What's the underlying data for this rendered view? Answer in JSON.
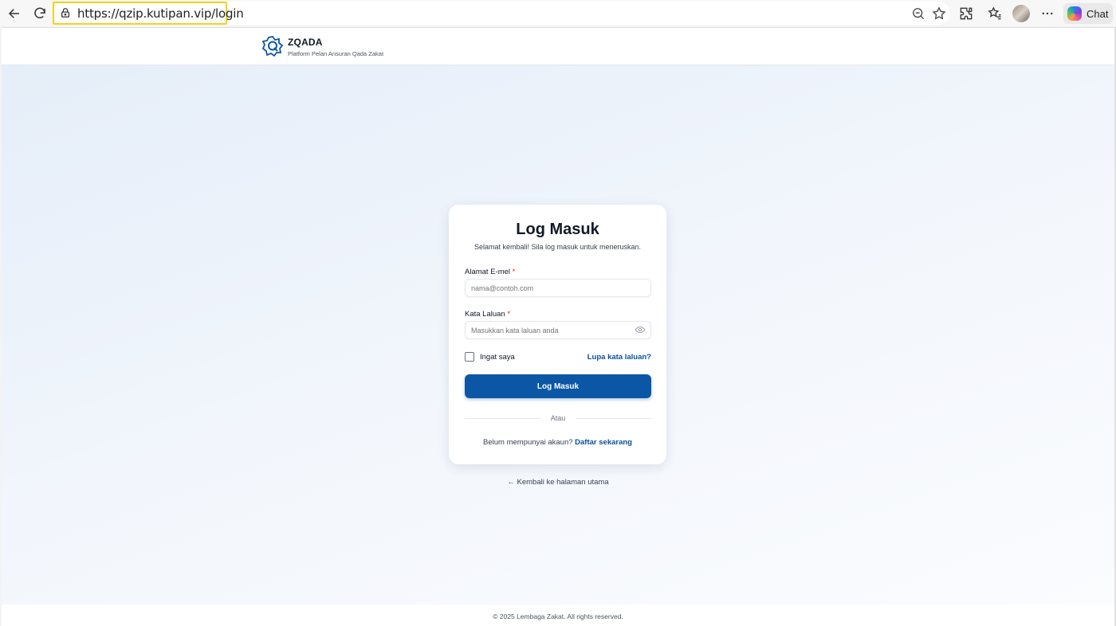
{
  "browser": {
    "url": "https://qzip.kutipan.vip/login",
    "chat_label": "Chat"
  },
  "header": {
    "brand_name": "ZQADA",
    "brand_tagline": "Platform Pelan Ansuran Qada Zakat"
  },
  "login": {
    "title": "Log Masuk",
    "subtitle": "Selamat kembali! Sila log masuk untuk meneruskan.",
    "email_label": "Alamat E-mel",
    "email_placeholder": "nama@contoh.com",
    "password_label": "Kata Laluan",
    "password_placeholder": "Masukkan kata laluan anda",
    "required_mark": "*",
    "remember_label": "Ingat saya",
    "forgot_label": "Lupa kata laluan?",
    "submit_label": "Log Masuk",
    "divider_label": "Atau",
    "signup_prompt": "Belum mempunyai akaun?",
    "signup_link": "Daftar sekarang"
  },
  "back_home": "← Kembali ke halaman utama",
  "footer": {
    "copyright": "© 2025 Lembaga Zakat. All rights reserved."
  },
  "colors": {
    "primary": "#0b57a6",
    "link": "#0b4f9c",
    "required": "#dc2626"
  }
}
